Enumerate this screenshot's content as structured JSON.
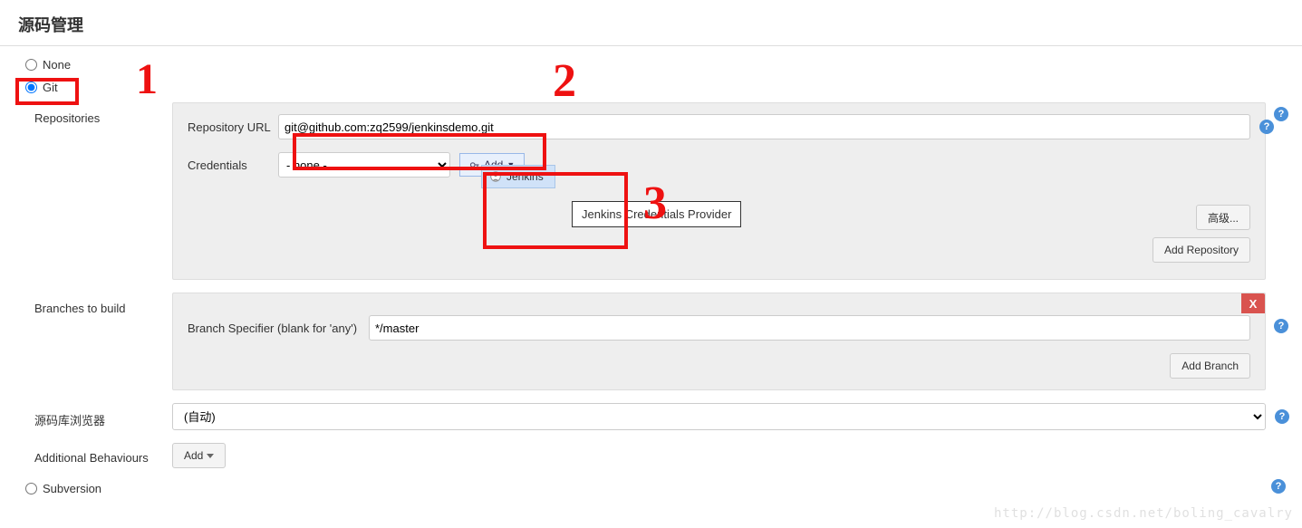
{
  "header": {
    "title": "源码管理"
  },
  "scm": {
    "none_label": "None",
    "git_label": "Git",
    "subversion_label": "Subversion",
    "selected": "git"
  },
  "repositories": {
    "section_label": "Repositories",
    "url_label": "Repository URL",
    "url_value": "git@github.com:zq2599/jenkinsdemo.git",
    "credentials_label": "Credentials",
    "credentials_value": "- none -",
    "add_button_label": "Add",
    "dropdown_item_label": "Jenkins",
    "tooltip_text": "Jenkins Credentials Provider",
    "advanced_button_label": "高级...",
    "add_repo_button_label": "Add Repository"
  },
  "branches": {
    "section_label": "Branches to build",
    "specifier_label": "Branch Specifier (blank for 'any')",
    "specifier_value": "*/master",
    "add_branch_button_label": "Add Branch",
    "delete_label": "X"
  },
  "browser": {
    "section_label": "源码库浏览器",
    "value": "(自动)"
  },
  "behaviours": {
    "section_label": "Additional Behaviours",
    "add_button_label": "Add"
  },
  "annotations": {
    "n1": "1",
    "n2": "2",
    "n3": "3"
  },
  "watermark": "http://blog.csdn.net/boling_cavalry"
}
